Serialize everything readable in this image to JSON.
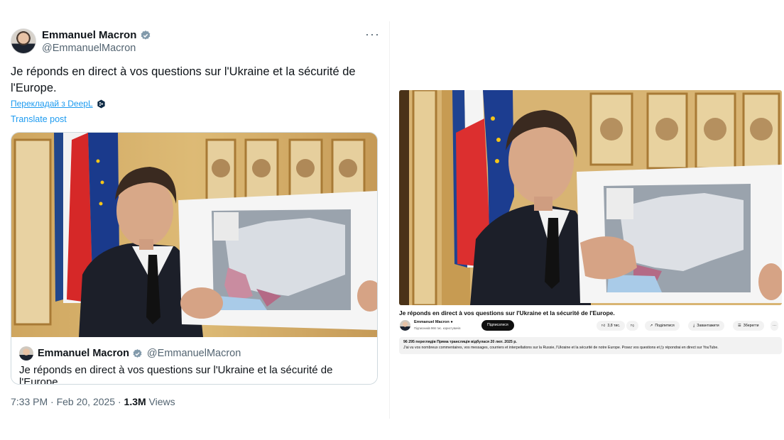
{
  "tweet": {
    "author_name": "Emmanuel Macron",
    "author_handle": "@EmmanuelMacron",
    "more_label": "···",
    "text": "Je réponds en direct à vos questions sur l'Ukraine et la sécurité de l'Europe.",
    "translate_deepl": "Перекладай з DeepL",
    "translate_post": "Translate post",
    "quote": {
      "author_name": "Emmanuel Macron",
      "author_handle": "@EmmanuelMacron",
      "text": "Je réponds en direct à vos questions sur l'Ukraine et la sécurité de l'Europe."
    },
    "meta": {
      "time": "7:33 PM · Feb 20, 2025 · ",
      "views_count": "1.3M",
      "views_label": " Views"
    }
  },
  "youtube": {
    "title": "Je réponds en direct à vos questions sur l'Ukraine et la sécurité de l'Europe.",
    "channel_name": "Emmanuel Macron",
    "channel_subs": "Підписників 966 тис. користувачів",
    "subscribe_label": "Підписатися",
    "like_count": "3,8 тис.",
    "share_label": "Поділитися",
    "download_label": "Завантажити",
    "save_label": "Зберегти",
    "more_label": "···",
    "views_line": "96 295 переглядів  Пряма трансляція відбулася 20 лют. 2025 р.",
    "description": "J'ai vu vos nombreux commentaires, vos messages, courriers et interpellations sur la Russie, l'Ukraine et la sécurité de notre Europe. Posez vos questions et j'y répondrai en direct sur YouTube."
  },
  "colors": {
    "x_blue": "#1d9bf0",
    "x_text": "#0f1419",
    "x_secondary": "#536471",
    "yt_black": "#0f0f0f"
  }
}
